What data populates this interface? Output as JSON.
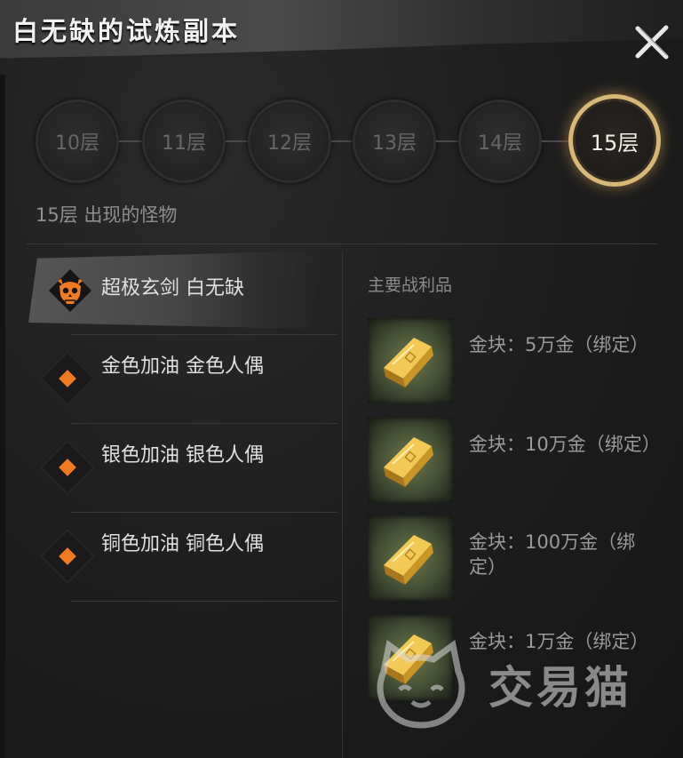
{
  "window": {
    "title": "白无缺的试炼副本",
    "close_icon": "close-icon"
  },
  "levels": [
    {
      "label": "10层",
      "active": false
    },
    {
      "label": "11层",
      "active": false
    },
    {
      "label": "12层",
      "active": false
    },
    {
      "label": "13层",
      "active": false
    },
    {
      "label": "14层",
      "active": false
    },
    {
      "label": "15层",
      "active": true
    }
  ],
  "level_caption": "15层 出现的怪物",
  "monsters": [
    {
      "name": "超极玄剑 白无缺",
      "icon": "demon-skull-icon",
      "boss": true
    },
    {
      "name": "金色加油 金色人偶",
      "icon": "orange-diamond-icon",
      "boss": false
    },
    {
      "name": "银色加油 银色人偶",
      "icon": "orange-diamond-icon",
      "boss": false
    },
    {
      "name": "铜色加油 铜色人偶",
      "icon": "orange-diamond-icon",
      "boss": false
    }
  ],
  "loot": {
    "heading": "主要战利品",
    "items": [
      {
        "text": "金块：5万金（绑定）",
        "icon": "gold-bar-icon"
      },
      {
        "text": "金块：10万金（绑定）",
        "icon": "gold-bar-icon"
      },
      {
        "text": "金块：100万金（绑定）",
        "icon": "gold-bar-icon"
      },
      {
        "text": "金块：1万金（绑定）",
        "icon": "gold-bar-icon"
      }
    ]
  },
  "watermark": {
    "text": "交易猫",
    "icon": "cat-logo-icon"
  },
  "colors": {
    "accent_orange": "#f07b22",
    "active_ring": "#d8b878",
    "background": "#1c1c1c"
  }
}
